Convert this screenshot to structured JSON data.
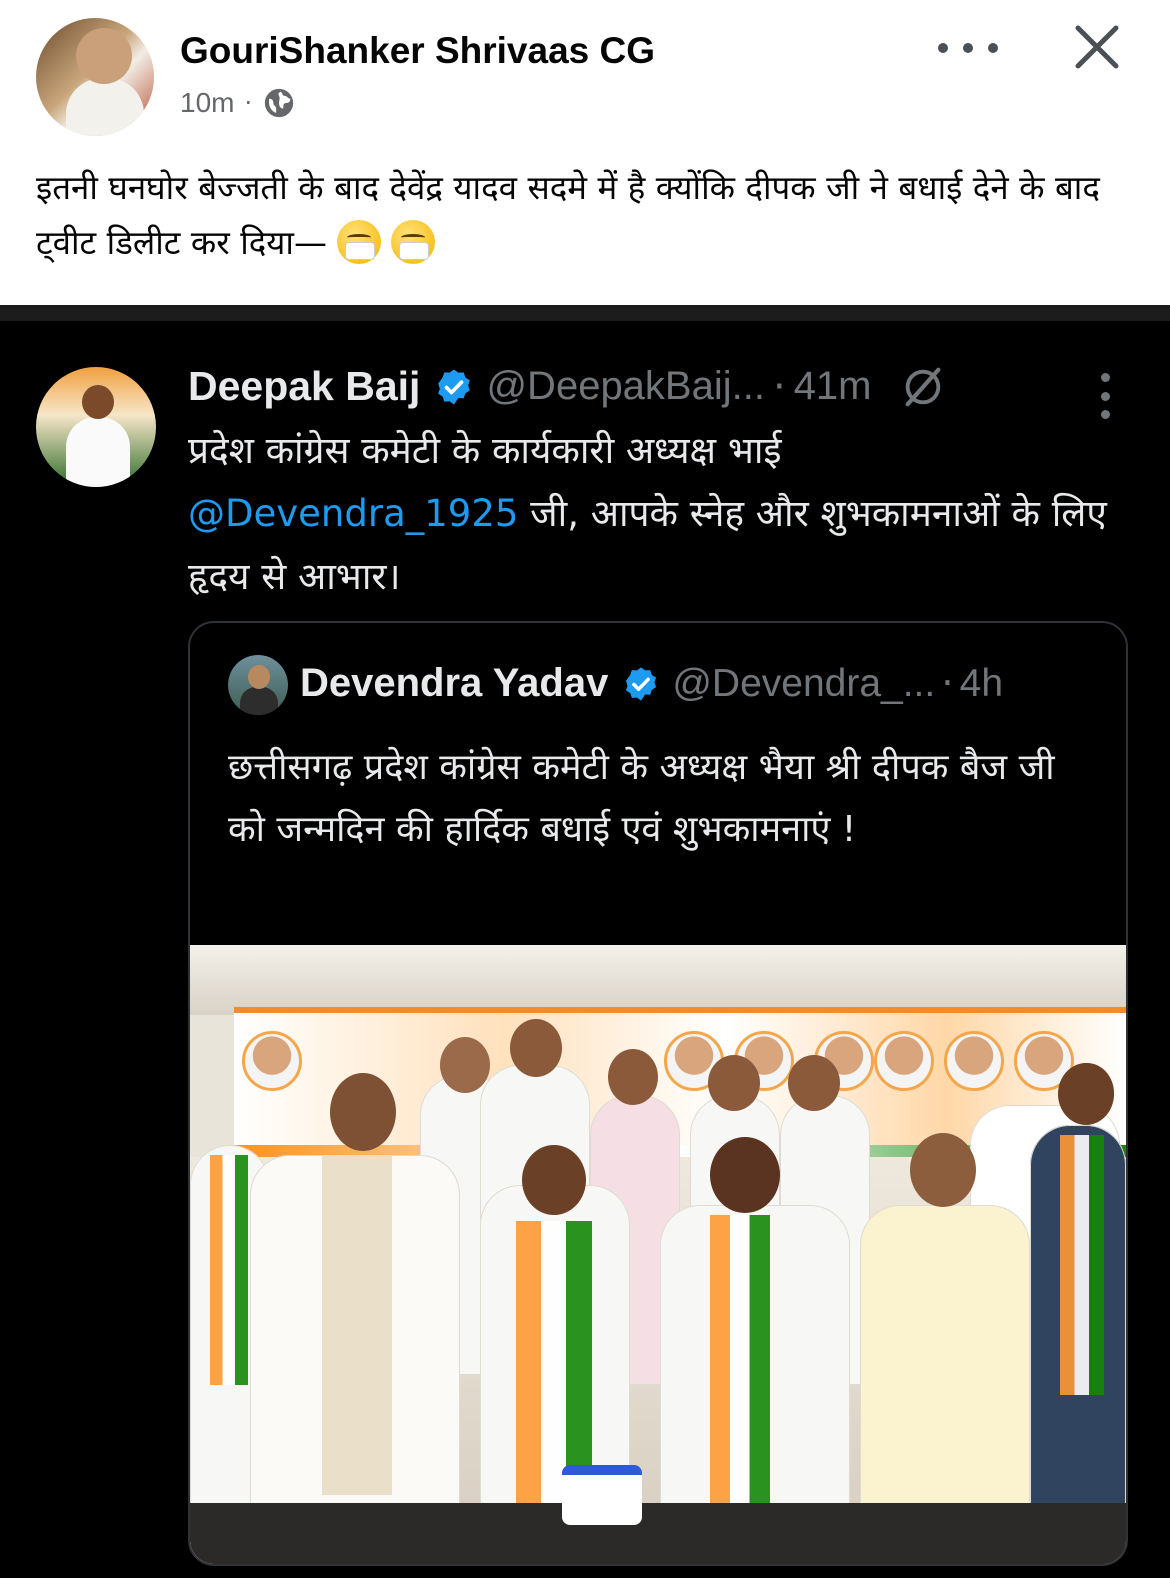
{
  "post": {
    "author": "GouriShanker Shrivaas CG",
    "time": "10m",
    "separator": "·",
    "text": "इतनी घनघोर बेज्जती के बाद देवेंद्र यादव सदमे में है क्योंकि दीपक जी ने बधाई देने के बाद ट्वीट डिलीट कर दिया—",
    "icons": {
      "visibility": "globe-icon",
      "more": "more-icon",
      "close": "close-icon",
      "emoji": "face-with-medical-mask"
    }
  },
  "tweet": {
    "name": "Deepak Baij",
    "handle": "@DeepakBaij...",
    "separator": "·",
    "time": "41m",
    "text_before": "प्रदेश कांग्रेस कमेटी के कार्यकारी अध्यक्ष भाई",
    "mention": "@Devendra_1925",
    "text_after": " जी, आपके स्नेह और शुभकामनाओं के लिए हृदय से आभार।",
    "icons": {
      "verified": "verified-icon",
      "grok": "grok-icon",
      "more": "more-icon"
    },
    "colors": {
      "background": "#000000",
      "text": "#e7e9ea",
      "muted": "#71767b",
      "link": "#1d9bf0",
      "verified": "#1d9bf0"
    }
  },
  "quoted": {
    "name": "Devendra Yadav",
    "handle": "@Devendra_...",
    "separator": "·",
    "time": "4h",
    "text": "छत्तीसगढ़ प्रदेश कांग्रेस कमेटी के अध्यक्ष भैया श्री दीपक बैज जी को जन्मदिन की हार्दिक बधाई एवं शुभकामनाएं !",
    "photo": "group-celebration-photo"
  }
}
